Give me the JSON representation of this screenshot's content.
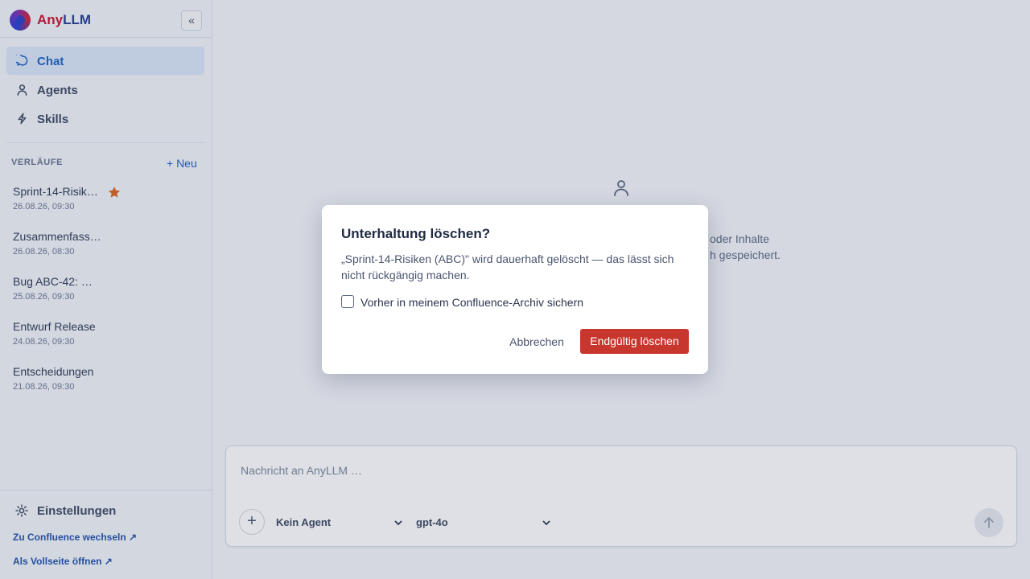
{
  "app": {
    "brand_part1": "Any",
    "brand_part2": "LLM",
    "collapse_label": "«"
  },
  "nav": {
    "items": [
      {
        "label": "Chat",
        "icon": "chat-bubble-icon",
        "active": true
      },
      {
        "label": "Agents",
        "icon": "person-icon",
        "active": false
      },
      {
        "label": "Skills",
        "icon": "lightning-icon",
        "active": false
      }
    ]
  },
  "history": {
    "title": "VERLÄUFE",
    "new_label": "+ Neu",
    "items": [
      {
        "title": "Sprint-14-Risiken (ABC)",
        "date": "26.08.26, 09:30",
        "starred": true
      },
      {
        "title": "Zusammenfassung",
        "date": "26.08.26, 08:30",
        "starred": false
      },
      {
        "title": "Bug ABC-42: …",
        "date": "25.08.26, 09:30",
        "starred": false
      },
      {
        "title": "Entwurf Release",
        "date": "24.08.26, 09:30",
        "starred": false
      },
      {
        "title": "Entscheidungen",
        "date": "21.08.26, 09:30",
        "starred": false
      }
    ]
  },
  "footer": {
    "settings_label": "Einstellungen",
    "confluence_link": "Zu Confluence wechseln ↗",
    "fullpage_link": "Als Vollseite öffnen ↗"
  },
  "main": {
    "empty_line1": "oder Inhalte",
    "empty_line2": "h gespeichert."
  },
  "composer": {
    "placeholder": "Nachricht an AnyLLM …",
    "agent_select": "Kein Agent",
    "model_select": "gpt-4o"
  },
  "dialog": {
    "title": "Unterhaltung löschen?",
    "body": "„Sprint-14-Risiken (ABC)\" wird dauerhaft gelöscht — das lässt sich nicht rückgängig machen.",
    "checkbox_label": "Vorher in meinem Confluence-Archiv sichern",
    "checkbox_checked": false,
    "cancel_label": "Abbrechen",
    "confirm_label": "Endgültig löschen"
  },
  "colors": {
    "accent": "#1a5fc4",
    "danger": "#c8372d",
    "star": "#d9621c"
  }
}
